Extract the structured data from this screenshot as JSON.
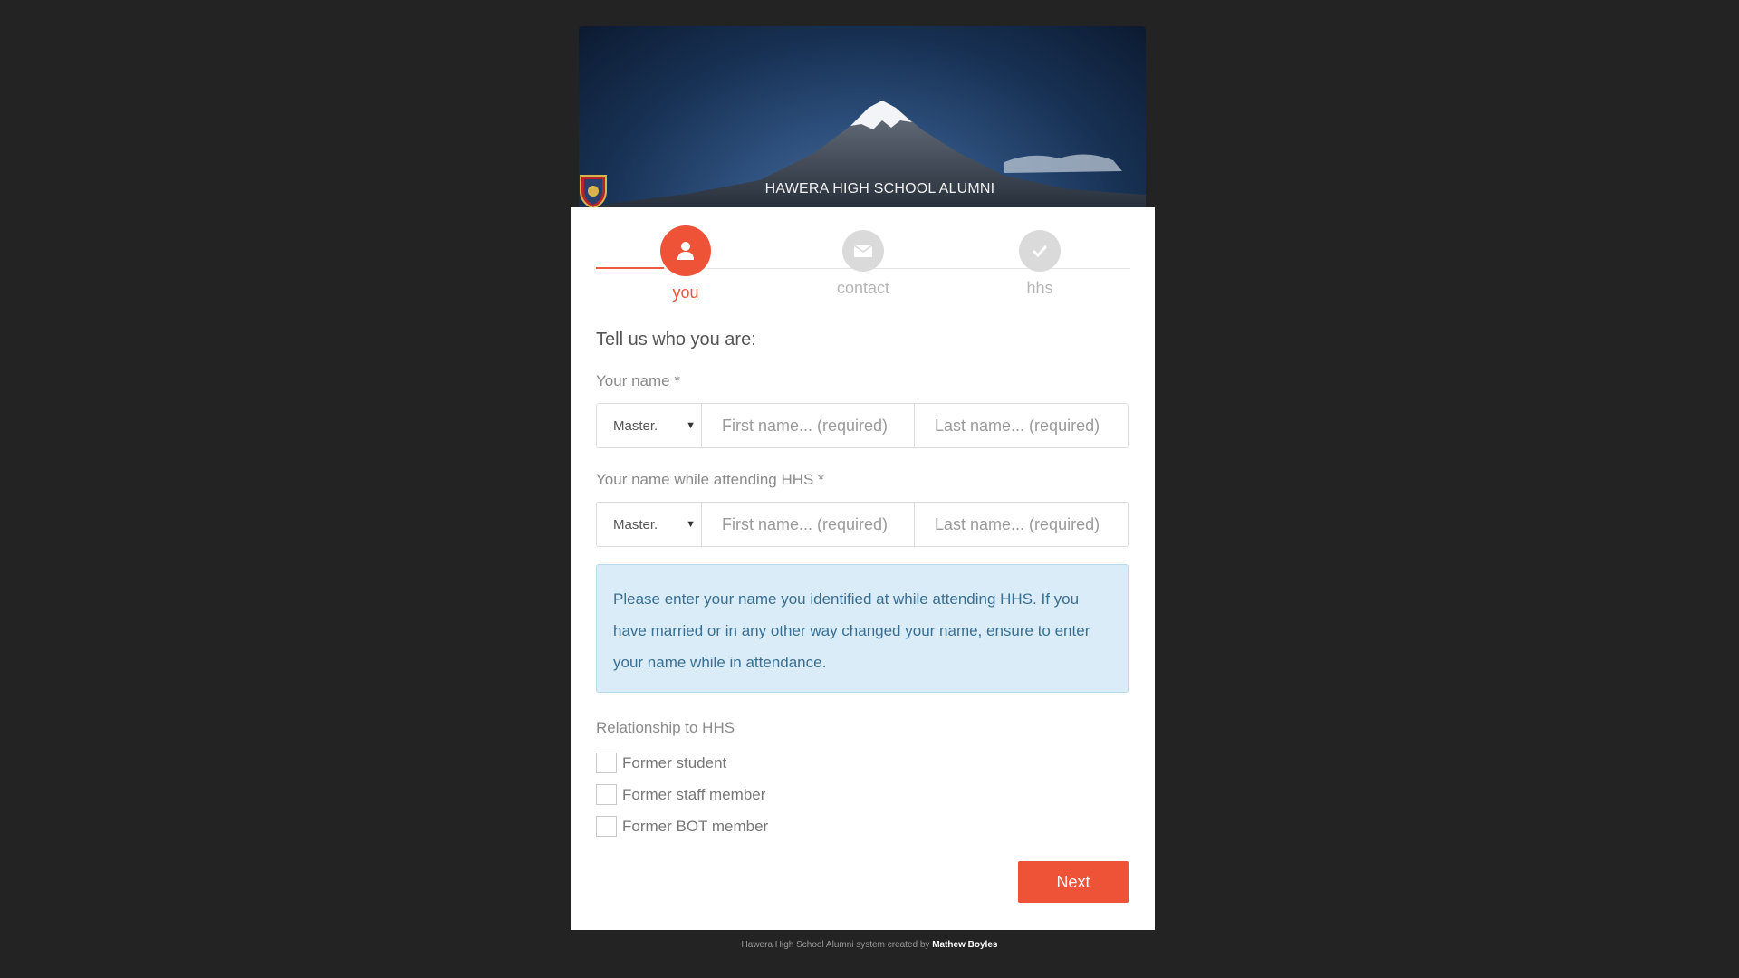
{
  "header": {
    "title": "HAWERA HIGH SCHOOL ALUMNI",
    "crest_icon": "school-crest-icon"
  },
  "steps": [
    {
      "label": "you",
      "icon": "user-icon",
      "state": "active"
    },
    {
      "label": "contact",
      "icon": "envelope-icon",
      "state": "inactive"
    },
    {
      "label": "hhs",
      "icon": "check-icon",
      "state": "inactive"
    }
  ],
  "form": {
    "heading": "Tell us who you are:",
    "current_name": {
      "label": "Your name *",
      "title_value": "Master.",
      "first_placeholder": "First name... (required)",
      "last_placeholder": "Last name... (required)"
    },
    "school_name": {
      "label": "Your name while attending HHS *",
      "title_value": "Master.",
      "first_placeholder": "First name... (required)",
      "last_placeholder": "Last name... (required)"
    },
    "info_text": "Please enter your name you identified at while attending HHS. If you have married or in any other way changed your name, ensure to enter your name while in attendance.",
    "relationship": {
      "label": "Relationship to HHS",
      "options": [
        "Former student",
        "Former staff member",
        "Former BOT member"
      ]
    },
    "next_label": "Next"
  },
  "footer": {
    "text": "Hawera High School Alumni system created by",
    "author": "Mathew Boyles"
  },
  "colors": {
    "accent": "#ee5338",
    "background": "#232323",
    "info_bg": "#d9ecf7",
    "info_text": "#3a6f92"
  }
}
